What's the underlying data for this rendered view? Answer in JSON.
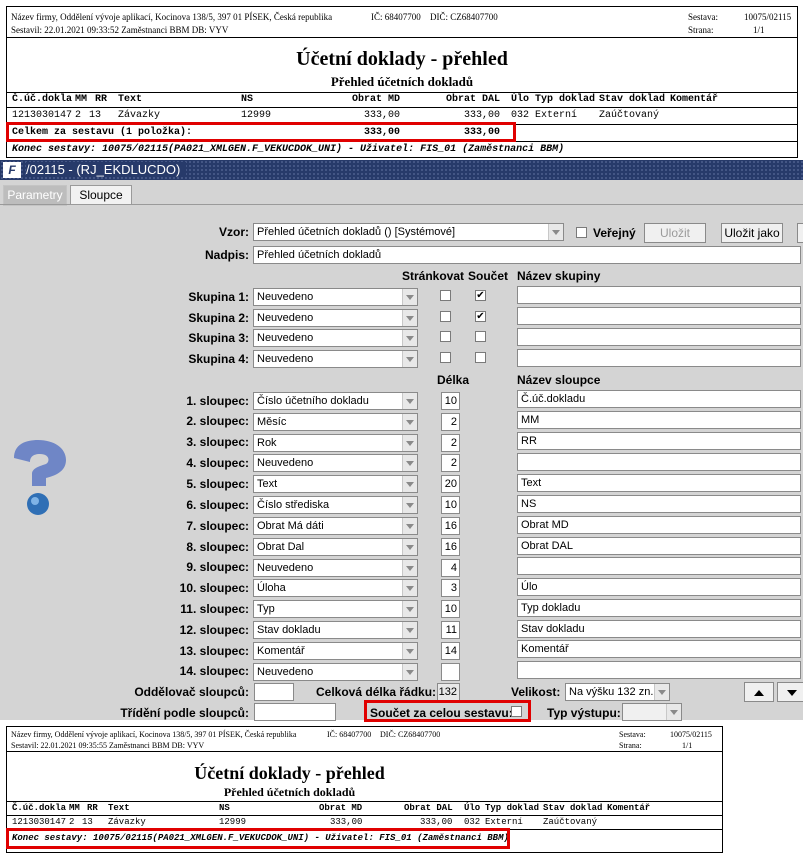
{
  "report1": {
    "company": "Název firmy, Oddělení vývoje aplikací, Kocinova 138/5, 397 01 PÍSEK, Česká republika",
    "ic": "IČ: 68407700",
    "dic": "DIČ: CZ68407700",
    "compiled": "Sestavil: 22.01.2021 09:33:52 Zaměstnanci BBM  DB: VYV",
    "sestava_label": "Sestava:",
    "sestava_value": "10075/02115",
    "strana_label": "Strana:",
    "strana_value": "1/1",
    "title": "Účetní doklady - přehled",
    "subtitle": "Přehled účetních dokladů",
    "headers": [
      "Č.úč.dokla",
      "MM",
      "RR",
      "Text",
      "NS",
      "Obrat MD",
      "Obrat DAL",
      "Úlo",
      "Typ doklad",
      "Stav doklad",
      "Komentář"
    ],
    "row": [
      "1213030147",
      "2",
      "13",
      "Závazky",
      "12999",
      "333,00",
      "333,00",
      "032",
      "Externí",
      "Zaúčtovaný",
      ""
    ],
    "total_label": "Celkem za sestavu (1 položka):",
    "total_md": "333,00",
    "total_dal": "333,00",
    "footer": "Konec sestavy: 10075/02115(PA021_XMLGEN.F_VEKUCDOK_UNI) - Uživatel: FIS_01 (Zaměstnanci BBM)"
  },
  "window": {
    "logo": "F",
    "title": "/02115 - (RJ_EKDLUCDO)"
  },
  "tabs": [
    "Parametry",
    "Sloupce"
  ],
  "form": {
    "vzor_label": "Vzor:",
    "vzor_value": "Přehled účetních dokladů  ()  [Systémové]",
    "verejny_label": "Veřejný",
    "ulozit": "Uložit",
    "ulozit_jako": "Uložit jako",
    "nadpis_label": "Nadpis:",
    "nadpis_value": "Přehled účetních dokladů",
    "col_strankovat": "Stránkovat",
    "col_soucet": "Součet",
    "col_nazev_skupiny": "Název skupiny",
    "col_delka": "Délka",
    "col_nazev_sloupce": "Název sloupce",
    "groups": [
      {
        "label": "Skupina 1:",
        "value": "Neuvedeno",
        "strankovat": "",
        "soucet": "✔",
        "name": ""
      },
      {
        "label": "Skupina 2:",
        "value": "Neuvedeno",
        "strankovat": "",
        "soucet": "✔",
        "name": ""
      },
      {
        "label": "Skupina 3:",
        "value": "Neuvedeno",
        "strankovat": "",
        "soucet": "",
        "name": ""
      },
      {
        "label": "Skupina 4:",
        "value": "Neuvedeno",
        "strankovat": "",
        "soucet": "",
        "name": ""
      }
    ],
    "columns": [
      {
        "label": "1. sloupec:",
        "value": "Číslo účetního dokladu",
        "len": "10",
        "name": "Č.úč.dokladu"
      },
      {
        "label": "2. sloupec:",
        "value": "Měsíc",
        "len": "2",
        "name": "MM"
      },
      {
        "label": "3. sloupec:",
        "value": "Rok",
        "len": "2",
        "name": "RR"
      },
      {
        "label": "4. sloupec:",
        "value": "Neuvedeno",
        "len": "2",
        "name": ""
      },
      {
        "label": "5. sloupec:",
        "value": "Text",
        "len": "20",
        "name": "Text"
      },
      {
        "label": "6. sloupec:",
        "value": "Číslo střediska",
        "len": "10",
        "name": "NS"
      },
      {
        "label": "7. sloupec:",
        "value": "Obrat Má dáti",
        "len": "16",
        "name": "Obrat MD"
      },
      {
        "label": "8. sloupec:",
        "value": "Obrat Dal",
        "len": "16",
        "name": "Obrat DAL"
      },
      {
        "label": "9. sloupec:",
        "value": "Neuvedeno",
        "len": "4",
        "name": ""
      },
      {
        "label": "10. sloupec:",
        "value": "Úloha",
        "len": "3",
        "name": "Úlo"
      },
      {
        "label": "11. sloupec:",
        "value": "Typ",
        "len": "10",
        "name": "Typ dokladu"
      },
      {
        "label": "12. sloupec:",
        "value": "Stav dokladu",
        "len": "11",
        "name": "Stav dokladu"
      },
      {
        "label": "13. sloupec:",
        "value": "Komentář",
        "len": "14",
        "name": "Komentář"
      },
      {
        "label": "14. sloupec:",
        "value": "Neuvedeno",
        "len": "",
        "name": ""
      }
    ],
    "oddelovac_label": "Oddělovač sloupců:",
    "celkova_label": "Celková délka řádku:",
    "celkova_value": "132",
    "velikost_label": "Velikost:",
    "velikost_value": "Na výšku 132 zn.",
    "trideni_label": "Třídění podle sloupců:",
    "soucet_celou_label": "Součet za celou sestavu:",
    "typ_vystupu_label": "Typ výstupu:"
  },
  "report2": {
    "company": "Název firmy, Oddělení vývoje aplikací, Kocinova 138/5, 397 01 PÍSEK, Česká republika",
    "ic": "IČ: 68407700",
    "dic": "DIČ: CZ68407700",
    "compiled": "Sestavil: 22.01.2021 09:35:55 Zaměstnanci BBM  DB: VYV",
    "sestava_label": "Sestava:",
    "sestava_value": "10075/02115",
    "strana_label": "Strana:",
    "strana_value": "1/1",
    "title": "Účetní doklady - přehled",
    "subtitle": "Přehled účetních dokladů",
    "headers": [
      "Č.úč.dokla",
      "MM",
      "RR",
      "Text",
      "NS",
      "Obrat MD",
      "Obrat DAL",
      "Úlo",
      "Typ doklad",
      "Stav doklad",
      "Komentář"
    ],
    "row": [
      "1213030147",
      "2",
      "13",
      "Závazky",
      "12999",
      "333,00",
      "333,00",
      "032",
      "Externí",
      "Zaúčtovaný",
      ""
    ],
    "footer": "Konec sestavy: 10075/02115(PA021_XMLGEN.F_VEKUCDOK_UNI) - Uživatel: FIS_01 (Zaměstnanci BBM)"
  }
}
